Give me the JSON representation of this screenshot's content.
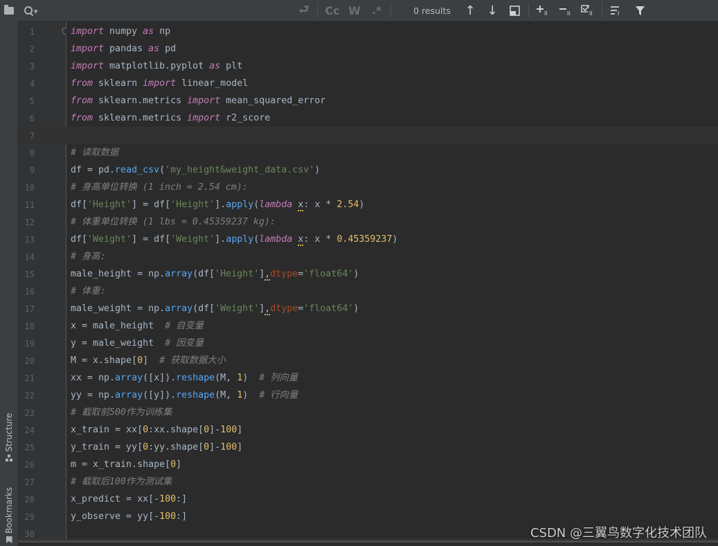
{
  "findbar": {
    "search_value": "",
    "option_labels": [
      "Cc",
      "W",
      ".*"
    ],
    "results_text": "0 results"
  },
  "side_tabs": {
    "structure": "Structure",
    "bookmarks": "Bookmarks"
  },
  "watermark": "CSDN @三翼鸟数字化技术团队",
  "code_lines": [
    {
      "n": "1",
      "html": "<span class='kwi'>import</span> numpy <span class='kwi'>as</span> np"
    },
    {
      "n": "2",
      "html": "<span class='kwi'>import</span> pandas <span class='kwi'>as</span> pd"
    },
    {
      "n": "3",
      "html": "<span class='kwi'>import</span> matplotlib.pyplot <span class='kwi'>as</span> plt"
    },
    {
      "n": "4",
      "html": "<span class='kwi'>from</span> sklearn <span class='kwi'>import</span> linear_model"
    },
    {
      "n": "5",
      "html": "<span class='kwi'>from</span> sklearn.metrics <span class='kwi'>import</span> mean_squared_error"
    },
    {
      "n": "6",
      "html": "<span class='kwi'>from</span> sklearn.metrics <span class='kwi'>import</span> r2_score"
    },
    {
      "n": "7",
      "html": ""
    },
    {
      "n": "8",
      "html": "<span class='cmt'># 读取数据</span>"
    },
    {
      "n": "9",
      "html": "df = pd.<span class='fn'>read_csv</span>(<span class='str'>'my_height&amp;weight_data.csv'</span>)"
    },
    {
      "n": "10",
      "html": "<span class='cmt'># 身高单位转换 (1 inch = 2.54 cm):</span>"
    },
    {
      "n": "11",
      "html": "df[<span class='str'>'Height'</span>] = df[<span class='str'>'Height'</span>].<span class='fn'>apply</span>(<span class='kwi'>lambda</span> <span class='squig'>x</span>: x * <span class='brk'>2.54</span>)"
    },
    {
      "n": "12",
      "html": "<span class='cmt'># 体重单位转换 (1 lbs = 0.45359237 kg):</span>"
    },
    {
      "n": "13",
      "html": "df[<span class='str'>'Weight'</span>] = df[<span class='str'>'Weight'</span>].<span class='fn'>apply</span>(<span class='kwi'>lambda</span> <span class='squig'>x</span>: x * <span class='brk'>0.45359237</span>)"
    },
    {
      "n": "14",
      "html": "<span class='cmt'># 身高:</span>"
    },
    {
      "n": "15",
      "html": "male_height = np.<span class='fn'>array</span>(df[<span class='str'>'Height'</span>]<span class='squig'>,</span><span class='kwarg'>dtype</span>=<span class='str'>'float64'</span>)"
    },
    {
      "n": "16",
      "html": "<span class='cmt'># 体重:</span>"
    },
    {
      "n": "17",
      "html": "male_weight = np.<span class='fn'>array</span>(df[<span class='str'>'Weight'</span>]<span class='squig'>,</span><span class='kwarg'>dtype</span>=<span class='str'>'float64'</span>)"
    },
    {
      "n": "18",
      "html": "x = male_height  <span class='cmt'># 自变量</span>"
    },
    {
      "n": "19",
      "html": "y = male_weight  <span class='cmt'># 因变量</span>"
    },
    {
      "n": "20",
      "html": "M = x.shape[<span class='brk'>0</span>]  <span class='cmt'># 获取数据大小</span>"
    },
    {
      "n": "21",
      "html": "xx = np.<span class='fn'>array</span>([x]).<span class='fn'>reshape</span>(M, <span class='brk'>1</span>)  <span class='cmt'># 列向量</span>"
    },
    {
      "n": "22",
      "html": "yy = np.<span class='fn'>array</span>([y]).<span class='fn'>reshape</span>(M, <span class='brk'>1</span>)  <span class='cmt'># 行向量</span>"
    },
    {
      "n": "23",
      "html": "<span class='cmt'># 截取前500作为训练集</span>"
    },
    {
      "n": "24",
      "html": "x_train = xx[<span class='brk'>0</span>:xx.shape[<span class='brk'>0</span>]-<span class='brk'>100</span>]"
    },
    {
      "n": "25",
      "html": "y_train = yy[<span class='brk'>0</span>:yy.shape[<span class='brk'>0</span>]-<span class='brk'>100</span>]"
    },
    {
      "n": "26",
      "html": "m = x_train.shape[<span class='brk'>0</span>]"
    },
    {
      "n": "27",
      "html": "<span class='cmt'># 截取后100作为测试集</span>"
    },
    {
      "n": "28",
      "html": "x_predict = xx[-<span class='brk'>100</span>:]"
    },
    {
      "n": "29",
      "html": "y_observe = yy[-<span class='brk'>100</span>:]"
    },
    {
      "n": "30",
      "html": ""
    }
  ]
}
